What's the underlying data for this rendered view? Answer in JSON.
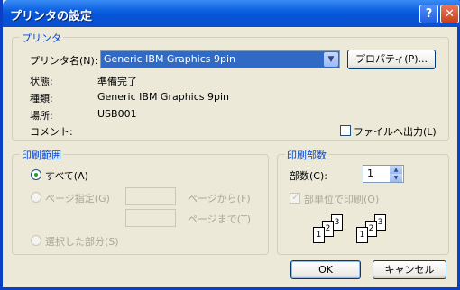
{
  "window": {
    "title": "プリンタの設定",
    "help_glyph": "?",
    "close_glyph": "✕"
  },
  "printer": {
    "legend": "プリンタ",
    "name_label": "プリンタ名(N):",
    "name_value": "Generic IBM Graphics 9pin",
    "properties_button": "プロパティ(P)...",
    "status_label": "状態:",
    "status_value": "準備完了",
    "type_label": "種類:",
    "type_value": "Generic IBM Graphics 9pin",
    "location_label": "場所:",
    "location_value": "USB001",
    "comment_label": "コメント:",
    "print_to_file": "ファイルへ出力(L)",
    "print_to_file_checked": false
  },
  "range": {
    "legend": "印刷範囲",
    "all": "すべて(A)",
    "pages": "ページ指定(G)",
    "from": "ページから(F)",
    "to": "ページまで(T)",
    "selection": "選択した部分(S)",
    "selected": "all"
  },
  "copies": {
    "legend": "印刷部数",
    "count_label": "部数(C):",
    "count_value": "1",
    "collate": "部単位で印刷(O)",
    "collate_checked": true
  },
  "buttons": {
    "ok": "OK",
    "cancel": "キャンセル"
  },
  "collate_pages": [
    "1",
    "2",
    "3"
  ]
}
